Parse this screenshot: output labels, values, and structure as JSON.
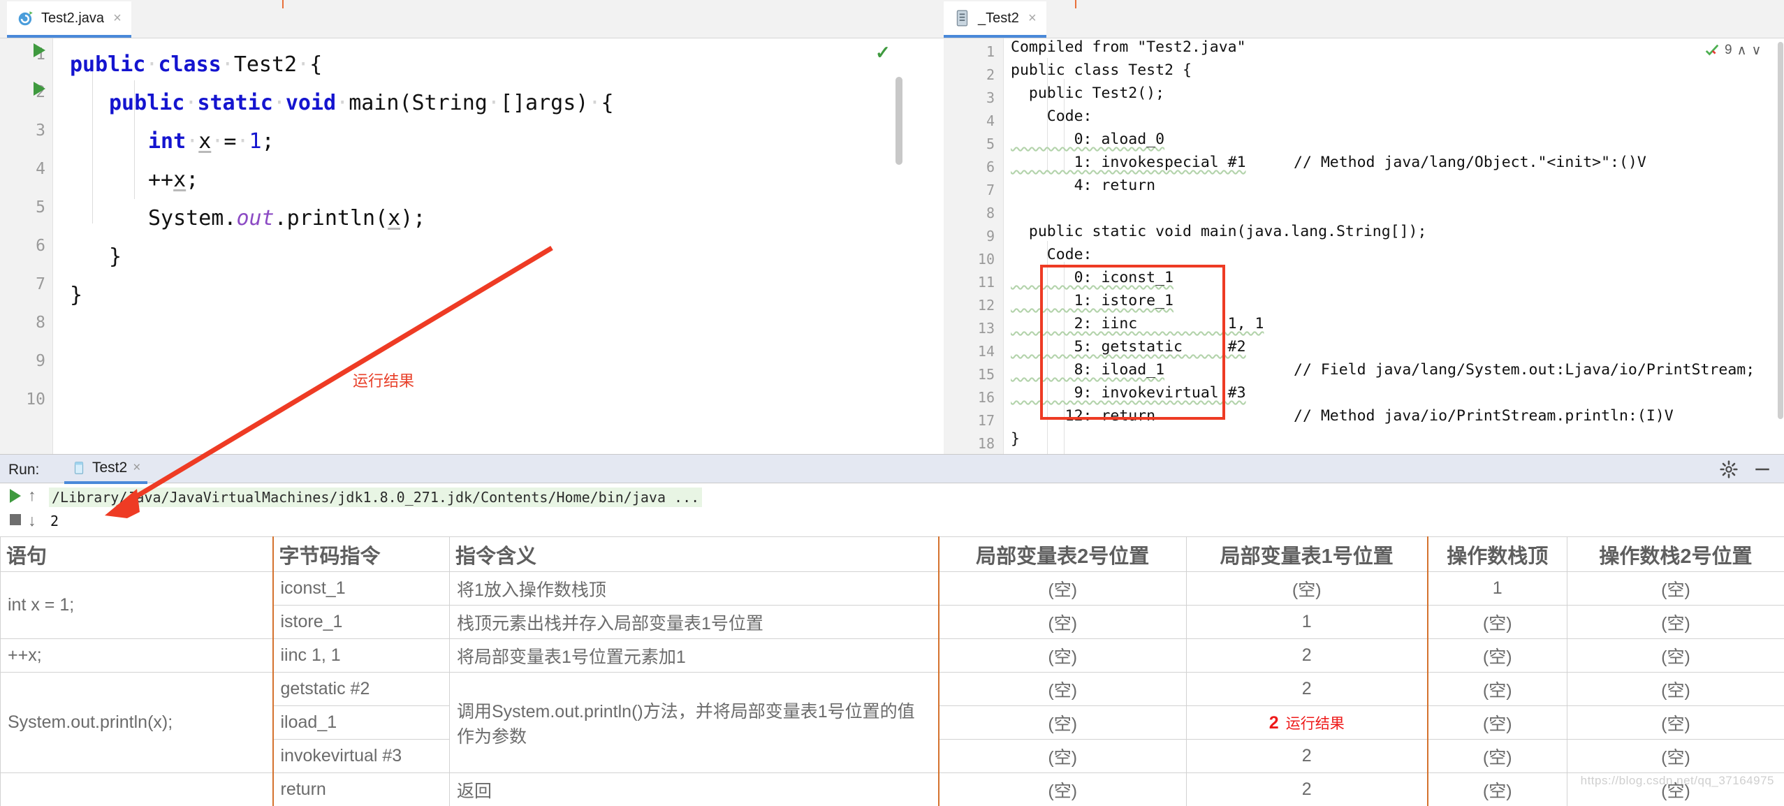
{
  "window": {
    "left_tab": {
      "label": "Test2.java",
      "icon": "java-class-icon",
      "close": "×"
    },
    "right_tab": {
      "label": "_Test2",
      "icon": "bytecode-file-icon",
      "close": "×"
    },
    "inspections": {
      "count": "9",
      "up": "∧",
      "down": "∨",
      "mark": "✓"
    },
    "editor_status_check": "✓"
  },
  "editor": {
    "line_numbers": [
      "1",
      "2",
      "3",
      "4",
      "5",
      "6",
      "7",
      "8",
      "9",
      "10"
    ],
    "lines": [
      {
        "n": "1",
        "text": "public class Test2 {"
      },
      {
        "n": "2",
        "text": "public static void main(String []args) {"
      },
      {
        "n": "3",
        "text": "int x = 1;"
      },
      {
        "n": "4",
        "text": "++x;"
      },
      {
        "n": "5",
        "text": "System.out.println(x);"
      },
      {
        "n": "6",
        "text": "}"
      },
      {
        "n": "7",
        "text": "}"
      },
      {
        "n": "8",
        "text": ""
      },
      {
        "n": "9",
        "text": ""
      },
      {
        "n": "10",
        "text": ""
      }
    ]
  },
  "bytecode": {
    "line_numbers": [
      "1",
      "2",
      "3",
      "4",
      "5",
      "6",
      "7",
      "8",
      "9",
      "10",
      "11",
      "12",
      "13",
      "14",
      "15",
      "16",
      "17",
      "18"
    ],
    "lines": [
      {
        "n": "1",
        "code": "Compiled from \"Test2.java\"",
        "comment": ""
      },
      {
        "n": "2",
        "code": "public class Test2 {",
        "comment": ""
      },
      {
        "n": "3",
        "code": "  public Test2();",
        "comment": ""
      },
      {
        "n": "4",
        "code": "    Code:",
        "comment": ""
      },
      {
        "n": "5",
        "code": "       0: aload_0",
        "comment": ""
      },
      {
        "n": "6",
        "code": "       1: invokespecial #1",
        "comment": "// Method java/lang/Object.\"<init>\":()V"
      },
      {
        "n": "7",
        "code": "       4: return",
        "comment": ""
      },
      {
        "n": "8",
        "code": "",
        "comment": ""
      },
      {
        "n": "9",
        "code": "  public static void main(java.lang.String[]);",
        "comment": ""
      },
      {
        "n": "10",
        "code": "    Code:",
        "comment": ""
      },
      {
        "n": "11",
        "code": "       0: iconst_1",
        "comment": ""
      },
      {
        "n": "12",
        "code": "       1: istore_1",
        "comment": ""
      },
      {
        "n": "13",
        "code": "       2: iinc          1, 1",
        "comment": ""
      },
      {
        "n": "14",
        "code": "       5: getstatic     #2",
        "comment": "// Field java/lang/System.out:Ljava/io/PrintStream;"
      },
      {
        "n": "15",
        "code": "       8: iload_1",
        "comment": ""
      },
      {
        "n": "16",
        "code": "       9: invokevirtual #3",
        "comment": "// Method java/io/PrintStream.println:(I)V"
      },
      {
        "n": "17",
        "code": "      12: return",
        "comment": ""
      },
      {
        "n": "18",
        "code": "}",
        "comment": ""
      }
    ],
    "highlight_box_label": "main-bytecode-highlight"
  },
  "run_panel": {
    "label": "Run:",
    "tab": "Test2",
    "tab_close": "×",
    "command": "/Library/Java/JavaVirtualMachines/jdk1.8.0_271.jdk/Contents/Home/bin/java ...",
    "output": "2",
    "settings_icon": "gear-icon",
    "minimize_icon": "minimize-icon",
    "rerun_icon": "run-icon",
    "stop_icon": "stop-icon",
    "up_icon": "arrow-up-icon",
    "down_icon": "arrow-down-icon"
  },
  "annotation": {
    "arrow_label": "运行结果",
    "arrow_color": "#ee3b24"
  },
  "table": {
    "headers": [
      "语句",
      "字节码指令",
      "指令含义",
      "局部变量表2号位置",
      "局部变量表1号位置",
      "操作数栈顶",
      "操作数栈2号位置"
    ],
    "rows": [
      {
        "stmt": "int x = 1;",
        "instruction": "iconst_1",
        "meaning": "将1放入操作数栈顶",
        "lv2": "(空)",
        "lv1": "(空)",
        "top": "1",
        "st2": "(空)",
        "top_red": false,
        "note": ""
      },
      {
        "stmt": "",
        "instruction": "istore_1",
        "meaning": "栈顶元素出栈并存入局部变量表1号位置",
        "lv2": "(空)",
        "lv1": "1",
        "top": "(空)",
        "st2": "(空)",
        "top_red": false,
        "note": ""
      },
      {
        "stmt": "++x;",
        "instruction": "iinc      1, 1",
        "meaning": "将局部变量表1号位置元素加1",
        "lv2": "(空)",
        "lv1": "2",
        "top": "(空)",
        "st2": "(空)",
        "top_red": false,
        "note": ""
      },
      {
        "stmt": "",
        "instruction": "getstatic   #2",
        "meaning": "调用System.out.println()方法，并将局部变量表1号位置的值作为参数",
        "lv2": "(空)",
        "lv1": "2",
        "top": "(空)",
        "st2": "(空)",
        "top_red": false,
        "note": ""
      },
      {
        "stmt": "System.out.println(x);",
        "instruction": "iload_1",
        "meaning": "",
        "lv2": "(空)",
        "lv1": "2",
        "top": "(空)",
        "st2": "(空)",
        "top_red": true,
        "note": "运行结果"
      },
      {
        "stmt": "",
        "instruction": "invokevirtual #3",
        "meaning": "",
        "lv2": "(空)",
        "lv1": "2",
        "top": "(空)",
        "st2": "(空)",
        "top_red": false,
        "note": ""
      },
      {
        "stmt": "",
        "instruction": "return",
        "meaning": "返回",
        "lv2": "(空)",
        "lv1": "2",
        "top": "(空)",
        "st2": "(空)",
        "top_red": false,
        "note": ""
      }
    ],
    "watermark": "https://blog.csdn.net/qq_37164975"
  }
}
